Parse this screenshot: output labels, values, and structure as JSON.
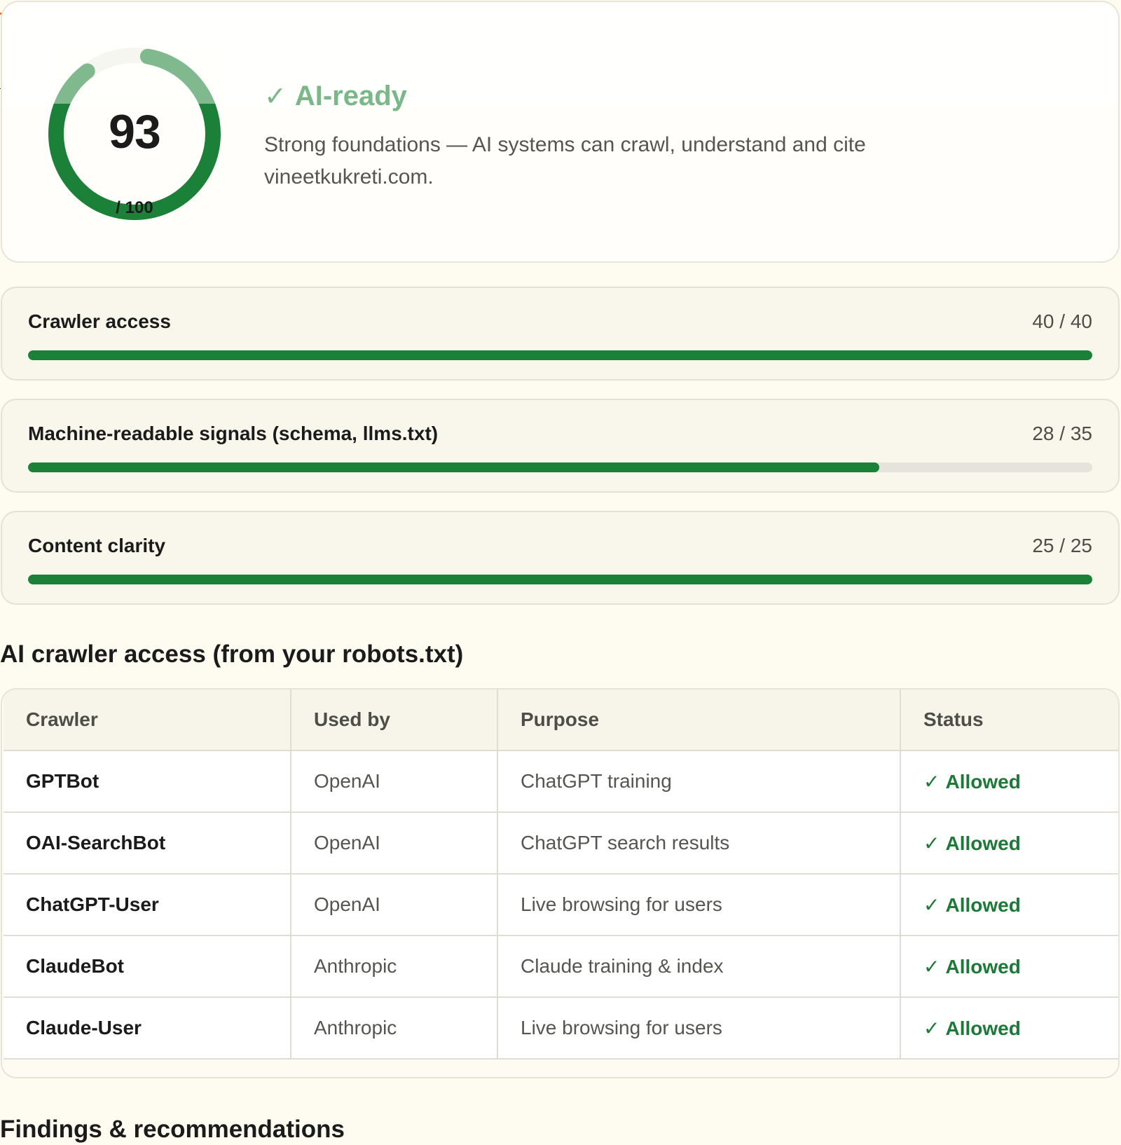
{
  "score": {
    "value": "93",
    "max_label": "/ 100",
    "fraction": 0.93,
    "verdict_label": "AI-ready",
    "verdict_icon": "check-icon",
    "summary": "Strong foundations — AI systems can crawl, understand and cite vineetkukreti.com.",
    "colors": {
      "ring": "#1b8038",
      "ring_light": "#7fb98b",
      "track": "#eeeeea",
      "verdict": "#78b987"
    }
  },
  "metrics": [
    {
      "label": "Crawler access",
      "score": "40 / 40",
      "value": 40,
      "max": 40
    },
    {
      "label": "Machine-readable signals (schema, llms.txt)",
      "score": "28 / 35",
      "value": 28,
      "max": 35
    },
    {
      "label": "Content clarity",
      "score": "25 / 25",
      "value": 25,
      "max": 25
    }
  ],
  "crawler_section": {
    "title": "AI crawler access (from your robots.txt)",
    "headers": [
      "Crawler",
      "Used by",
      "Purpose",
      "Status"
    ],
    "rows": [
      {
        "crawler": "GPTBot",
        "used_by": "OpenAI",
        "purpose": "ChatGPT training",
        "status": "Allowed"
      },
      {
        "crawler": "OAI-SearchBot",
        "used_by": "OpenAI",
        "purpose": "ChatGPT search results",
        "status": "Allowed"
      },
      {
        "crawler": "ChatGPT-User",
        "used_by": "OpenAI",
        "purpose": "Live browsing for users",
        "status": "Allowed"
      },
      {
        "crawler": "ClaudeBot",
        "used_by": "Anthropic",
        "purpose": "Claude training & index",
        "status": "Allowed"
      },
      {
        "crawler": "Claude-User",
        "used_by": "Anthropic",
        "purpose": "Live browsing for users",
        "status": "Allowed"
      }
    ],
    "status_icon": "check-icon",
    "status_color": "#1b7a36"
  },
  "findings_section": {
    "title": "Findings & recommendations"
  }
}
